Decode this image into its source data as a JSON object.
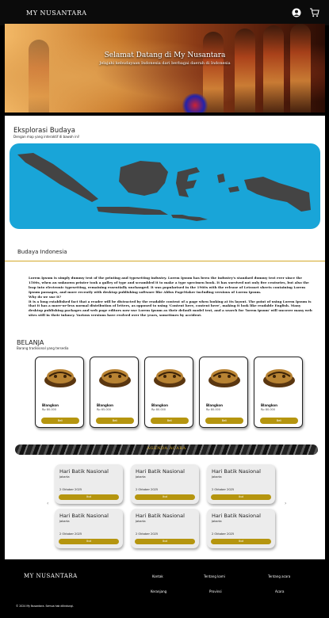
{
  "navbar": {
    "brand": "MY NUSANTARA",
    "icons": [
      "user-icon",
      "cart-icon"
    ]
  },
  "hero": {
    "title": "Selamat Datang di My Nusantara",
    "subtitle": "Jelajahi kebudayaan Indonesia dari berbagai daerah di Indonesia"
  },
  "explore": {
    "title": "Eksplorasi Budaya",
    "subtitle": "Dengan map yang interaktif di bawah ini!",
    "map_color": "#19a5d8"
  },
  "budaya": {
    "title": "Budaya Indonesia",
    "paragraph1": "Lorem Ipsum is simply dummy text of the printing and typesetting industry. Lorem Ipsum has been the industry's standard dummy text ever since the 1500s, when an unknown printer took a galley of type and scrambled it to make a type specimen book. It has survived not only five centuries, but also the leap into electronic typesetting, remaining essentially unchanged. It was popularised in the 1960s with the release of Letraset sheets containing Lorem Ipsum passages, and more recently with desktop publishing software like Aldus PageMaker including versions of Lorem Ipsum.",
    "question": "Why do we use it?",
    "paragraph2": "It is a long established fact that a reader will be distracted by the readable content of a page when looking at its layout. The point of using Lorem Ipsum is that it has a more-or-less normal distribution of letters, as opposed to using 'Content here, content here', making it look like readable English. Many desktop publishing packages and web page editors now use Lorem Ipsum as their default model text, and a search for 'lorem ipsum' will uncover many web sites still in their infancy. Various versions have evolved over the years, sometimes by accident."
  },
  "shop": {
    "title": "BELANJA",
    "subtitle": "Barang tradisional yang tersedia",
    "products": [
      {
        "name": "Blangkon",
        "price": "Rp 80.000",
        "button": "Beli"
      },
      {
        "name": "Blangkon",
        "price": "Rp 65.000",
        "button": "Beli"
      },
      {
        "name": "Blangkon",
        "price": "Rp 80.000",
        "button": "Beli"
      },
      {
        "name": "Blangkon",
        "price": "Rp 80.000",
        "button": "Beli"
      },
      {
        "name": "Blangkon",
        "price": "Rp 80.000",
        "button": "Beli"
      }
    ]
  },
  "agenda": {
    "banner": "AGENDA ACARA",
    "prev_arrow": "‹",
    "next_arrow": "›",
    "events": [
      {
        "title": "Hari Batik Nasional",
        "location": "Jakarta",
        "date": "2 Oktober 2025",
        "button": "Ikut"
      },
      {
        "title": "Hari Batik Nasional",
        "location": "Jakarta",
        "date": "2 Oktober 2025",
        "button": "Ikut"
      },
      {
        "title": "Hari Batik Nasional",
        "location": "Jakarta",
        "date": "2 Oktober 2025",
        "button": "Ikut"
      },
      {
        "title": "Hari Batik Nasional",
        "location": "Jakarta",
        "date": "2 Oktober 2025",
        "button": "Ikut"
      },
      {
        "title": "Hari Batik Nasional",
        "location": "Jakarta",
        "date": "2 Oktober 2025",
        "button": "Ikut"
      },
      {
        "title": "Hari Batik Nasional",
        "location": "Jakarta",
        "date": "2 Oktober 2025",
        "button": "Ikut"
      }
    ]
  },
  "footer": {
    "brand": "MY NUSANTARA",
    "links": [
      "Kontak",
      "Tentang kami",
      "Tentang acara",
      "Keranjang",
      "Provinsi",
      "Acara"
    ],
    "copyright": "© 2024 My Nusantara. Semua hak dilindungi."
  },
  "colors": {
    "accent": "#b5950f",
    "divider": "#d4a92a",
    "navbar": "#0b0b0b"
  }
}
